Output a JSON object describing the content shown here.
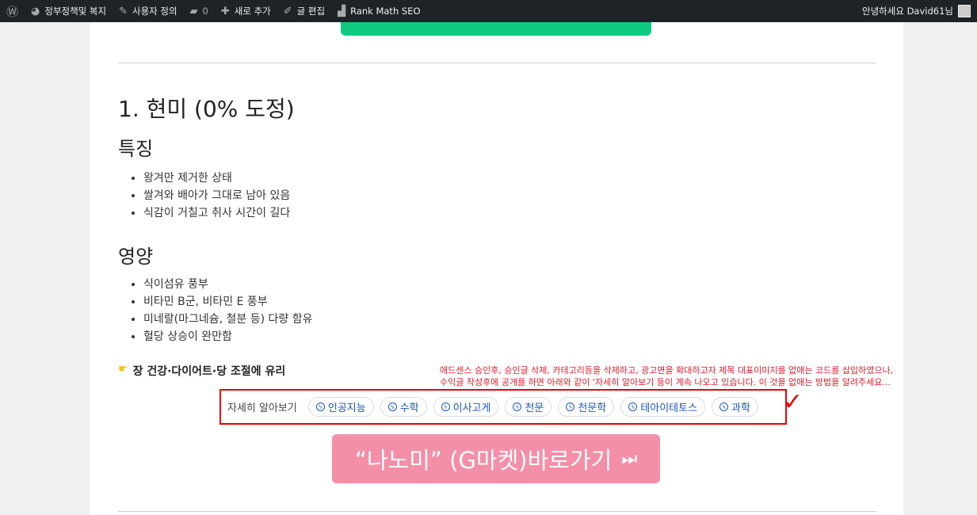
{
  "adminbar": {
    "site": "정부정책및 복지",
    "customize": "사용자 정의",
    "comments": "0",
    "new": "새로 추가",
    "edit": "글 편집",
    "seo": "Rank Math SEO",
    "greeting": "안녕하세요 David61님"
  },
  "article": {
    "title": "1. 현미 (0% 도정)",
    "features_heading": "특징",
    "features": [
      "왕겨만 제거한 상태",
      "쌀겨와 배아가 그대로 남아 있음",
      "식감이 거칠고 취사 시간이 길다"
    ],
    "nutrition_heading": "영양",
    "nutrition": [
      "식이섬유 풍부",
      "비타민 B군, 비타민 E 풍부",
      "미네랄(마그네슘, 철분 등) 다량 함유",
      "혈당 상승이 완만함"
    ],
    "tip": "장 건강·다이어트·당 조절에 유리"
  },
  "annotation": {
    "line1": "애드센스 승인후, 승인글 삭제, 카테고리등을 삭제하고, 광고면을 확대하고자 제목 대표이미지를 없애는 코드를 삽입하였으나,",
    "line2": "수익글 작성후에 공개를 하면 아래와 같이 '자세히 알아보기 등이 계속 나오고 있습니다.   이 것을 없애는 방법을 알려주세요..."
  },
  "more": {
    "label": "자세히 알아보기",
    "chips": [
      "인공지능",
      "수학",
      "이사고게",
      "천문",
      "천문학",
      "테아이테토스",
      "과학"
    ]
  },
  "cta": {
    "label": "“나노미” (G마켓)바로가기"
  }
}
